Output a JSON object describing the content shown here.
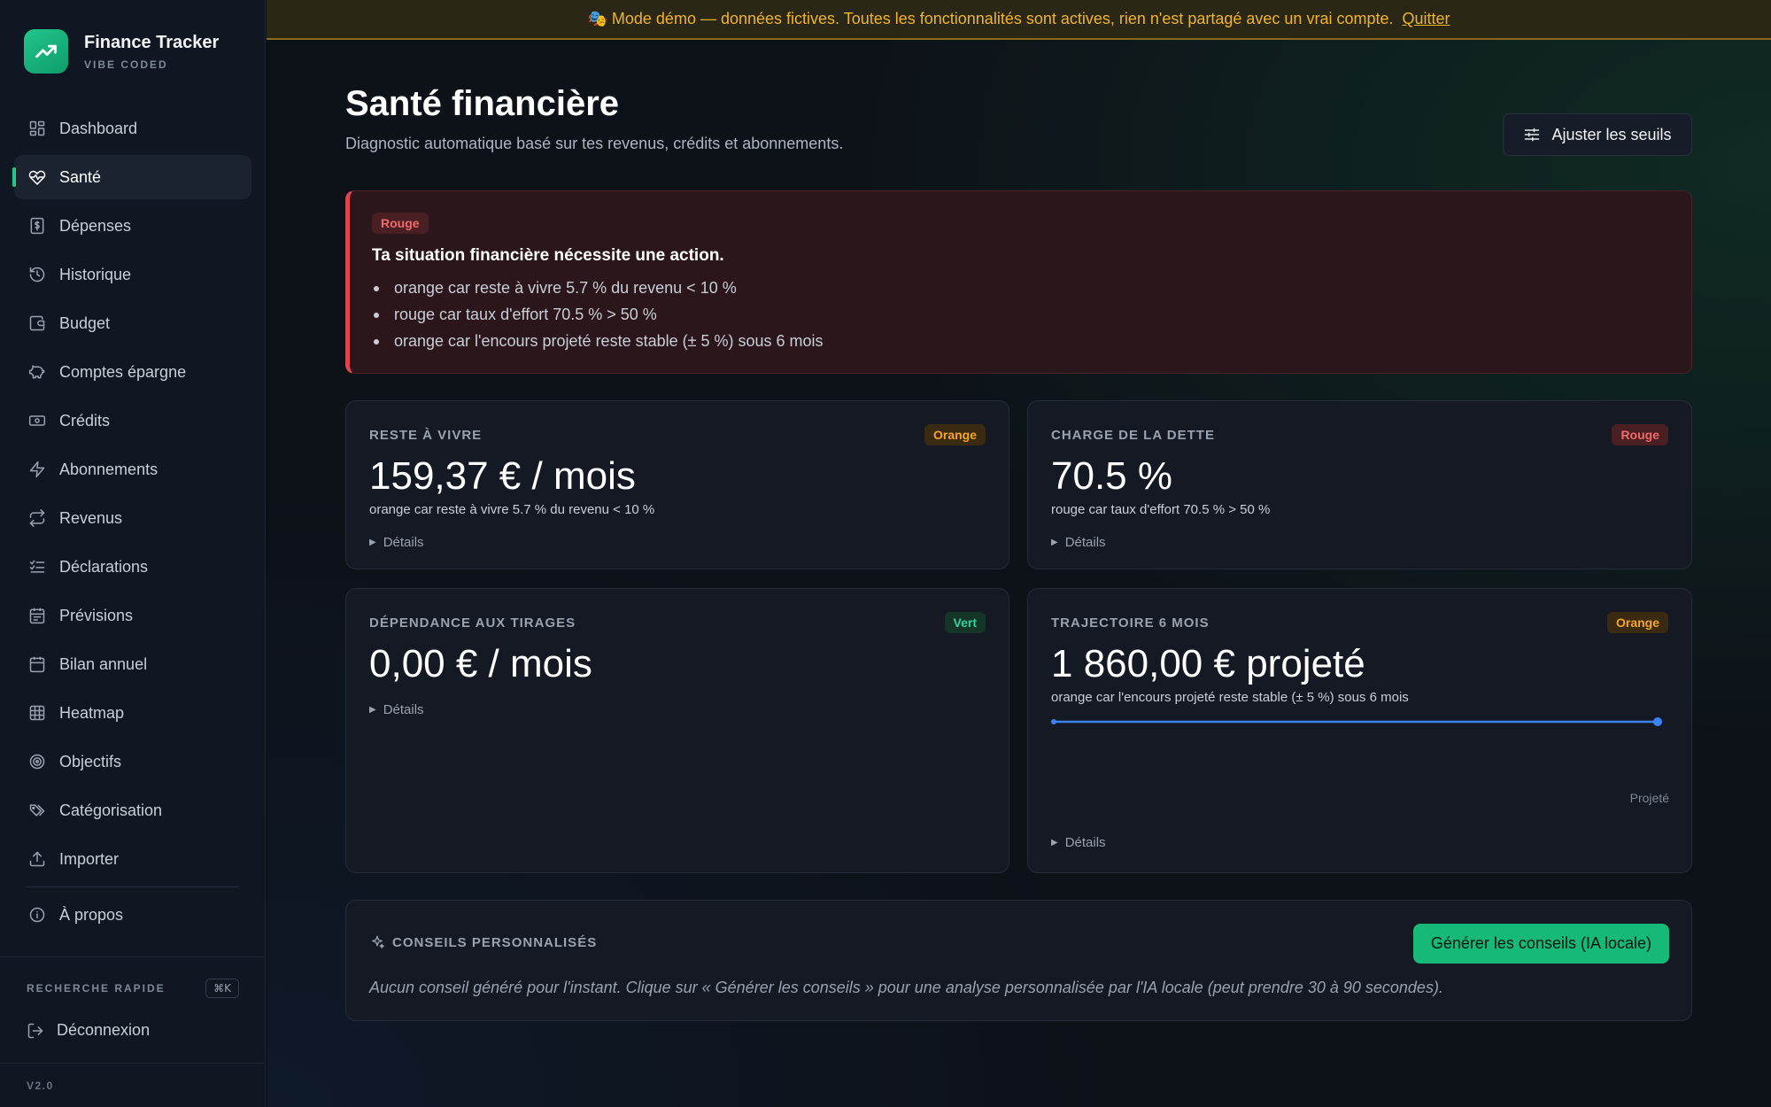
{
  "brand": {
    "name": "Finance Tracker",
    "sub": "VIBE CODED"
  },
  "sidebar": {
    "items": [
      {
        "label": "Dashboard",
        "icon": "dashboard-icon"
      },
      {
        "label": "Santé",
        "icon": "heart-pulse-icon",
        "active": true
      },
      {
        "label": "Dépenses",
        "icon": "receipt-dollar-icon"
      },
      {
        "label": "Historique",
        "icon": "history-icon"
      },
      {
        "label": "Budget",
        "icon": "wallet-icon"
      },
      {
        "label": "Comptes épargne",
        "icon": "piggy-bank-icon"
      },
      {
        "label": "Crédits",
        "icon": "banknote-icon"
      },
      {
        "label": "Abonnements",
        "icon": "lightning-icon"
      },
      {
        "label": "Revenus",
        "icon": "repeat-icon"
      },
      {
        "label": "Déclarations",
        "icon": "checklist-icon"
      },
      {
        "label": "Prévisions",
        "icon": "calendar-forecast-icon"
      },
      {
        "label": "Bilan annuel",
        "icon": "calendar-icon"
      },
      {
        "label": "Heatmap",
        "icon": "grid-icon"
      },
      {
        "label": "Objectifs",
        "icon": "target-icon"
      },
      {
        "label": "Catégorisation",
        "icon": "tags-icon"
      },
      {
        "label": "Importer",
        "icon": "upload-icon"
      }
    ],
    "about": {
      "label": "À propos",
      "icon": "info-icon"
    },
    "quick_search": {
      "label": "RECHERCHE RAPIDE",
      "shortcut": "⌘K"
    },
    "logout": "Déconnexion",
    "version": "V2.0"
  },
  "banner": {
    "text": "🎭 Mode démo — données fictives. Toutes les fonctionnalités sont actives, rien n'est partagé avec un vrai compte.",
    "quit": "Quitter"
  },
  "page": {
    "title": "Santé financière",
    "subtitle": "Diagnostic automatique basé sur tes revenus, crédits et abonnements.",
    "adjust_button": "Ajuster les seuils"
  },
  "alert": {
    "badge": "Rouge",
    "title": "Ta situation financière nécessite une action.",
    "reasons": [
      "orange car reste à vivre 5.7 % du revenu < 10 %",
      "rouge car taux d'effort 70.5 % > 50 %",
      "orange car l'encours projeté reste stable (± 5 %) sous 6 mois"
    ]
  },
  "cards": {
    "reste": {
      "label": "RESTE À VIVRE",
      "badge": "Orange",
      "value": "159,37 € / mois",
      "note": "orange car reste à vivre 5.7 % du revenu < 10 %",
      "details": "Détails"
    },
    "dette": {
      "label": "CHARGE DE LA DETTE",
      "badge": "Rouge",
      "value": "70.5 %",
      "note": "rouge car taux d'effort 70.5 % > 50 %",
      "details": "Détails"
    },
    "tirages": {
      "label": "DÉPENDANCE AUX TIRAGES",
      "badge": "Vert",
      "value": "0,00 € / mois",
      "details": "Détails"
    },
    "trajectoire": {
      "label": "TRAJECTOIRE 6 MOIS",
      "badge": "Orange",
      "value": "1 860,00 € projeté",
      "note": "orange car l'encours projeté reste stable (± 5 %) sous 6 mois",
      "legend": "Projeté",
      "details": "Détails"
    }
  },
  "advice": {
    "title": "CONSEILS PERSONNALISÉS",
    "button": "Générer les conseils (IA locale)",
    "empty_text": "Aucun conseil généré pour l'instant. Clique sur « Générer les conseils » pour une analyse personnalisée par l'IA locale (peut prendre 30 à 90 secondes)."
  },
  "colors": {
    "accent": "#22c58b",
    "danger": "#e0454f",
    "warning": "#f5a623",
    "success": "#34d399",
    "line": "#3b82f6"
  }
}
